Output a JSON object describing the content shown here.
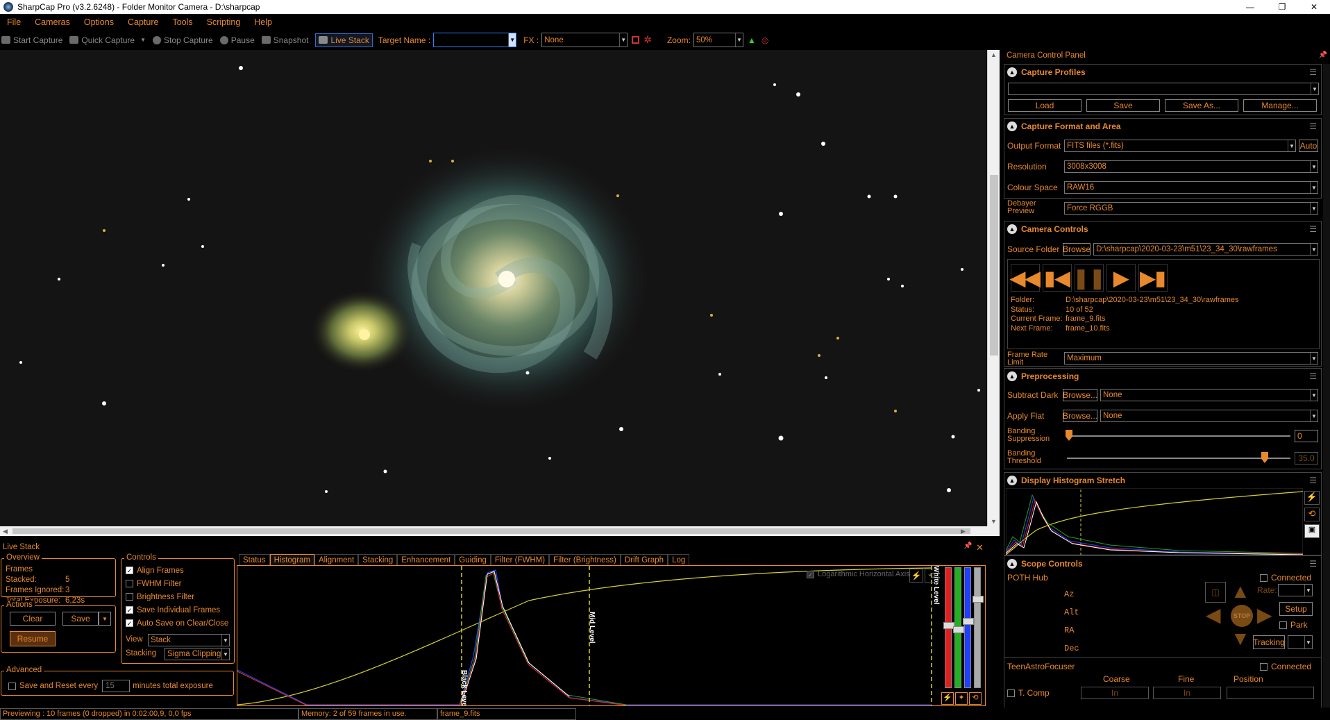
{
  "window": {
    "title": "SharpCap Pro (v3.2.6248) - Folder Monitor Camera - D:\\sharpcap",
    "minimize": "—",
    "maximize": "❐",
    "close": "✕"
  },
  "menu": [
    "File",
    "Cameras",
    "Options",
    "Capture",
    "Tools",
    "Scripting",
    "Help"
  ],
  "toolbar": {
    "start_capture": "Start Capture",
    "quick_capture": "Quick Capture",
    "stop_capture": "Stop Capture",
    "pause": "Pause",
    "snapshot": "Snapshot",
    "live_stack": "Live Stack",
    "target_name_label": "Target Name :",
    "target_name_value": "",
    "fx_label": "FX :",
    "fx_value": "None",
    "zoom_label": "Zoom:",
    "zoom_value": "50%"
  },
  "ccp": {
    "title": "Camera Control Panel",
    "capture_profiles": {
      "title": "Capture Profiles",
      "profile": "",
      "load": "Load",
      "save": "Save",
      "save_as": "Save As...",
      "manage": "Manage..."
    },
    "capture_format": {
      "title": "Capture Format and Area",
      "output_format_label": "Output Format",
      "output_format": "FITS files (*.fits)",
      "auto": "Auto",
      "resolution_label": "Resolution",
      "resolution": "3008x3008",
      "colour_space_label": "Colour Space",
      "colour_space": "RAW16",
      "debayer_label1": "Debayer",
      "debayer_label2": "Preview",
      "debayer": "Force RGGB"
    },
    "camera_controls": {
      "title": "Camera Controls",
      "source_folder_label": "Source Folder",
      "browse": "Browse",
      "source_folder": "D:\\sharpcap\\2020-03-23\\m51\\23_34_30\\rawframes",
      "folder_label": "Folder:",
      "folder": "D:\\sharpcap\\2020-03-23\\m51\\23_34_30\\rawframes",
      "status_label": "Status:",
      "status": "10 of 52",
      "current_label": "Current Frame:",
      "current": "frame_9.fits",
      "next_label": "Next Frame:",
      "next": "frame_10.fits",
      "frame_rate_label1": "Frame Rate",
      "frame_rate_label2": "Limit",
      "frame_rate": "Maximum"
    },
    "preprocessing": {
      "title": "Preprocessing",
      "subtract_dark_label": "Subtract Dark",
      "browse": "Browse...",
      "dark": "None",
      "apply_flat_label": "Apply Flat",
      "flat": "None",
      "banding_supp_label1": "Banding",
      "banding_supp_label2": "Suppression",
      "banding_supp": "0",
      "banding_thr_label1": "Banding",
      "banding_thr_label2": "Threshold",
      "banding_thr": "35.0"
    },
    "histogram_stretch": {
      "title": "Display Histogram Stretch"
    },
    "scope": {
      "title": "Scope Controls",
      "device": "POTH Hub",
      "connected": "Connected",
      "az": "Az",
      "alt": "Alt",
      "ra": "RA",
      "dec": "Dec",
      "rate": "Rate:",
      "setup": "Setup",
      "park": "Park",
      "tracking": "Tracking",
      "stop": "STOP"
    },
    "focuser": {
      "device": "TeenAstroFocuser",
      "connected": "Connected",
      "coarse": "Coarse",
      "fine": "Fine",
      "position": "Position",
      "tcomp": "T. Comp",
      "in1": "In",
      "in2": "In"
    }
  },
  "live_stack": {
    "title": "Live Stack",
    "overview": {
      "title": "Overview",
      "frames_stacked_label": "Frames Stacked:",
      "frames_stacked": "5",
      "frames_ignored_label": "Frames Ignored:",
      "frames_ignored": "3",
      "total_exposure_label": "Total Exposure:",
      "total_exposure": "6,23s"
    },
    "actions": {
      "title": "Actions",
      "clear": "Clear",
      "save": "Save",
      "resume": "Resume"
    },
    "advanced": {
      "title": "Advanced",
      "save_reset_label": "Save and Reset every",
      "minutes": "15",
      "suffix": "minutes total exposure"
    },
    "controls": {
      "title": "Controls",
      "align_frames": "Align Frames",
      "fwhm_filter": "FWHM Filter",
      "brightness_filter": "Brightness Filter",
      "save_individual": "Save Individual Frames",
      "auto_save": "Auto Save on Clear/Close",
      "view_label": "View",
      "view": "Stack",
      "stacking_label": "Stacking",
      "stacking": "Sigma Clipping"
    },
    "tabs": [
      "Status",
      "Histogram",
      "Alignment",
      "Stacking",
      "Enhancement",
      "Guiding",
      "Filter (FWHM)",
      "Filter (Brightness)",
      "Drift Graph",
      "Log"
    ],
    "histogram": {
      "log_axis": "Logarithmic Horizontal Axis",
      "black_level": "Black Level",
      "mid_level": "Mid Level",
      "white_level": "White Level"
    }
  },
  "statusbar": {
    "previewing": "Previewing : 10 frames (0 dropped) in 0:02:00,9, 0,0 fps",
    "memory": "Memory: 2 of 59 frames in use.",
    "file": "frame_9.fits"
  },
  "colors": {
    "accent": "#e8892b",
    "background": "#000000",
    "sky": "#151414"
  }
}
